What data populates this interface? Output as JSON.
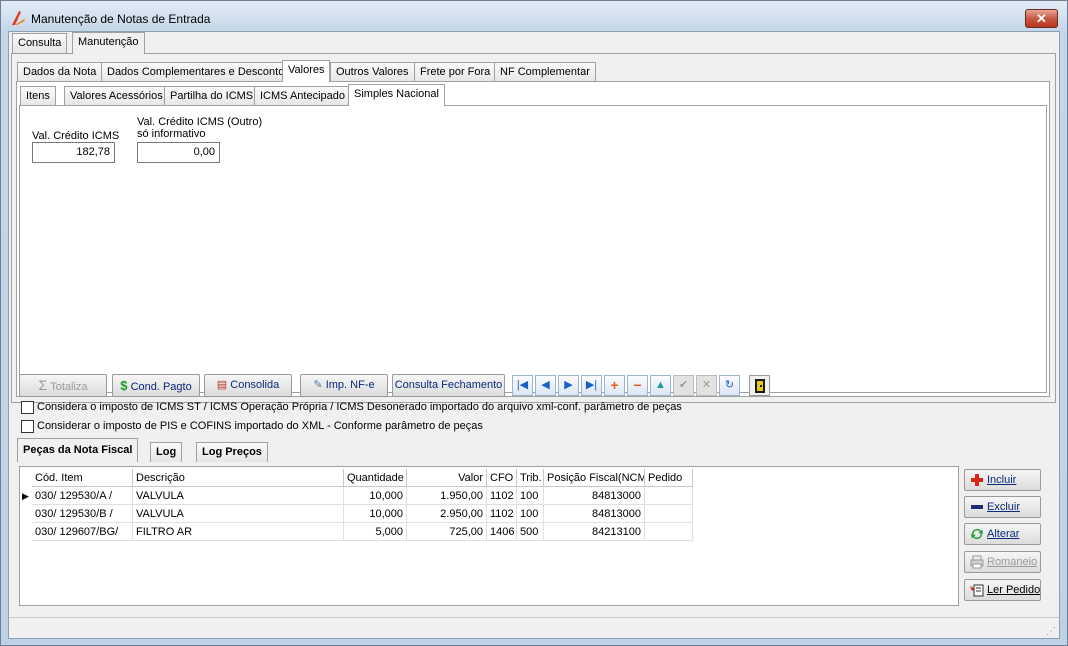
{
  "window": {
    "title": "Manutenção de Notas de Entrada",
    "close_label": "✕"
  },
  "main_tabs": [
    "Consulta",
    "Manutenção"
  ],
  "tabs_level1": [
    "Dados da Nota",
    "Dados Complementares e Desconto",
    "Valores",
    "Outros Valores",
    "Frete por Fora",
    "NF Complementar"
  ],
  "tabs_level2": [
    "Itens",
    "Valores Acessórios",
    "Partilha do ICMS",
    "ICMS Antecipado",
    "Simples Nacional"
  ],
  "simples": {
    "credito_label": "Val. Crédito ICMS",
    "credito_value": "182,78",
    "outro_label1": "Val. Crédito ICMS (Outro)",
    "outro_label2": "só informativo",
    "outro_value": "0,00"
  },
  "toolbar": {
    "totaliza": "Totaliza",
    "cond_pagto": "Cond. Pagto",
    "consolida": "Consolida",
    "imp_nfe": "Imp. NF-e",
    "consulta_fechamento": "Consulta Fechamento"
  },
  "nav_icons": [
    "first-record-icon",
    "prior-record-icon",
    "next-record-icon",
    "last-record-icon",
    "insert-icon",
    "delete-icon",
    "edit-icon",
    "post-icon",
    "cancel-icon",
    "refresh-icon"
  ],
  "options": {
    "icms_label": "Considera o imposto de ICMS ST / ICMS Operação Própria / ICMS Desonerado importado do arquivo xml-conf. parâmetro de peças",
    "pis_label": "Considerar o imposto de PIS e COFINS importado do XML - Conforme parâmetro de peças"
  },
  "bottom_tabs": [
    "Peças da Nota Fiscal",
    "Log",
    "Log Preços"
  ],
  "grid": {
    "columns": [
      "Cód. Item",
      "Descrição",
      "Quantidade",
      "Valor",
      "CFO",
      "Trib.",
      "Posição Fiscal(NCM)",
      "Pedido"
    ],
    "rows": [
      [
        "030/  129530/A /",
        "VALVULA",
        "10,000",
        "1.950,00",
        "1102",
        "100",
        "84813000",
        ""
      ],
      [
        "030/  129530/B /",
        "VALVULA",
        "10,000",
        "2.950,00",
        "1102",
        "100",
        "84813000",
        ""
      ],
      [
        "030/  129607/BG/",
        "FILTRO AR",
        "5,000",
        "725,00",
        "1406",
        "500",
        "84213100",
        ""
      ]
    ]
  },
  "side_buttons": {
    "incluir": "Incluir",
    "excluir": "Excluir",
    "alterar": "Alterar",
    "romaneio": "Romaneio",
    "ler_pedido": "Ler Pedido"
  },
  "colors": {
    "accent": "#0066cc",
    "nav_blue": "#1a5fc7",
    "add_red": "#d9261c",
    "remove_navy": "#1b2a7a",
    "refresh_green": "#1e9a2e"
  }
}
